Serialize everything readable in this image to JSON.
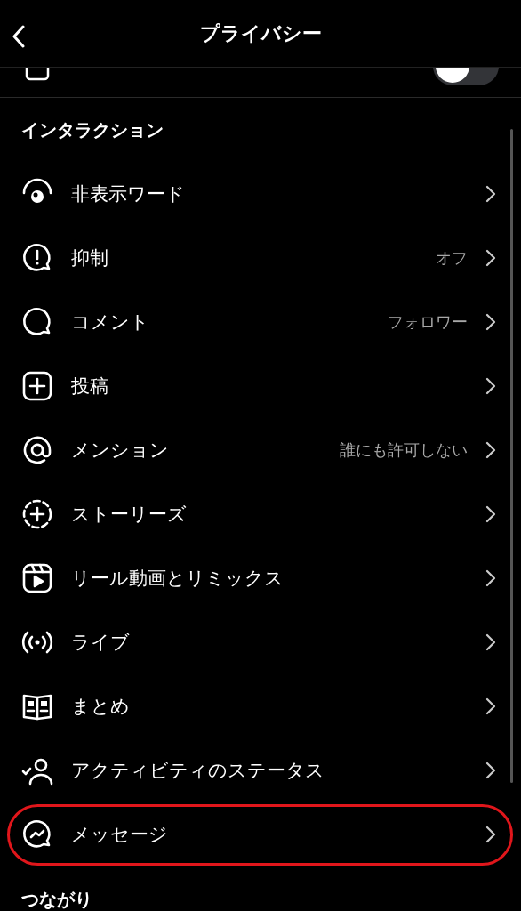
{
  "header": {
    "title": "プライバシー"
  },
  "partial_row": {
    "toggle": {
      "on": false
    }
  },
  "section": {
    "title": "インタラクション"
  },
  "items": [
    {
      "label": "非表示ワード",
      "highlighted": false
    },
    {
      "label": "抑制",
      "value": "オフ",
      "highlighted": false
    },
    {
      "label": "コメント",
      "value": "フォロワー",
      "highlighted": false
    },
    {
      "label": "投稿",
      "highlighted": false
    },
    {
      "label": "メンション",
      "value": "誰にも許可しない",
      "highlighted": false
    },
    {
      "label": "ストーリーズ",
      "highlighted": false
    },
    {
      "label": "リール動画とリミックス",
      "highlighted": false
    },
    {
      "label": "ライブ",
      "highlighted": false
    },
    {
      "label": "まとめ",
      "highlighted": false
    },
    {
      "label": "アクティビティのステータス",
      "highlighted": false
    },
    {
      "label": "メッセージ",
      "highlighted": true
    }
  ],
  "next_section": {
    "title": "つながり"
  }
}
